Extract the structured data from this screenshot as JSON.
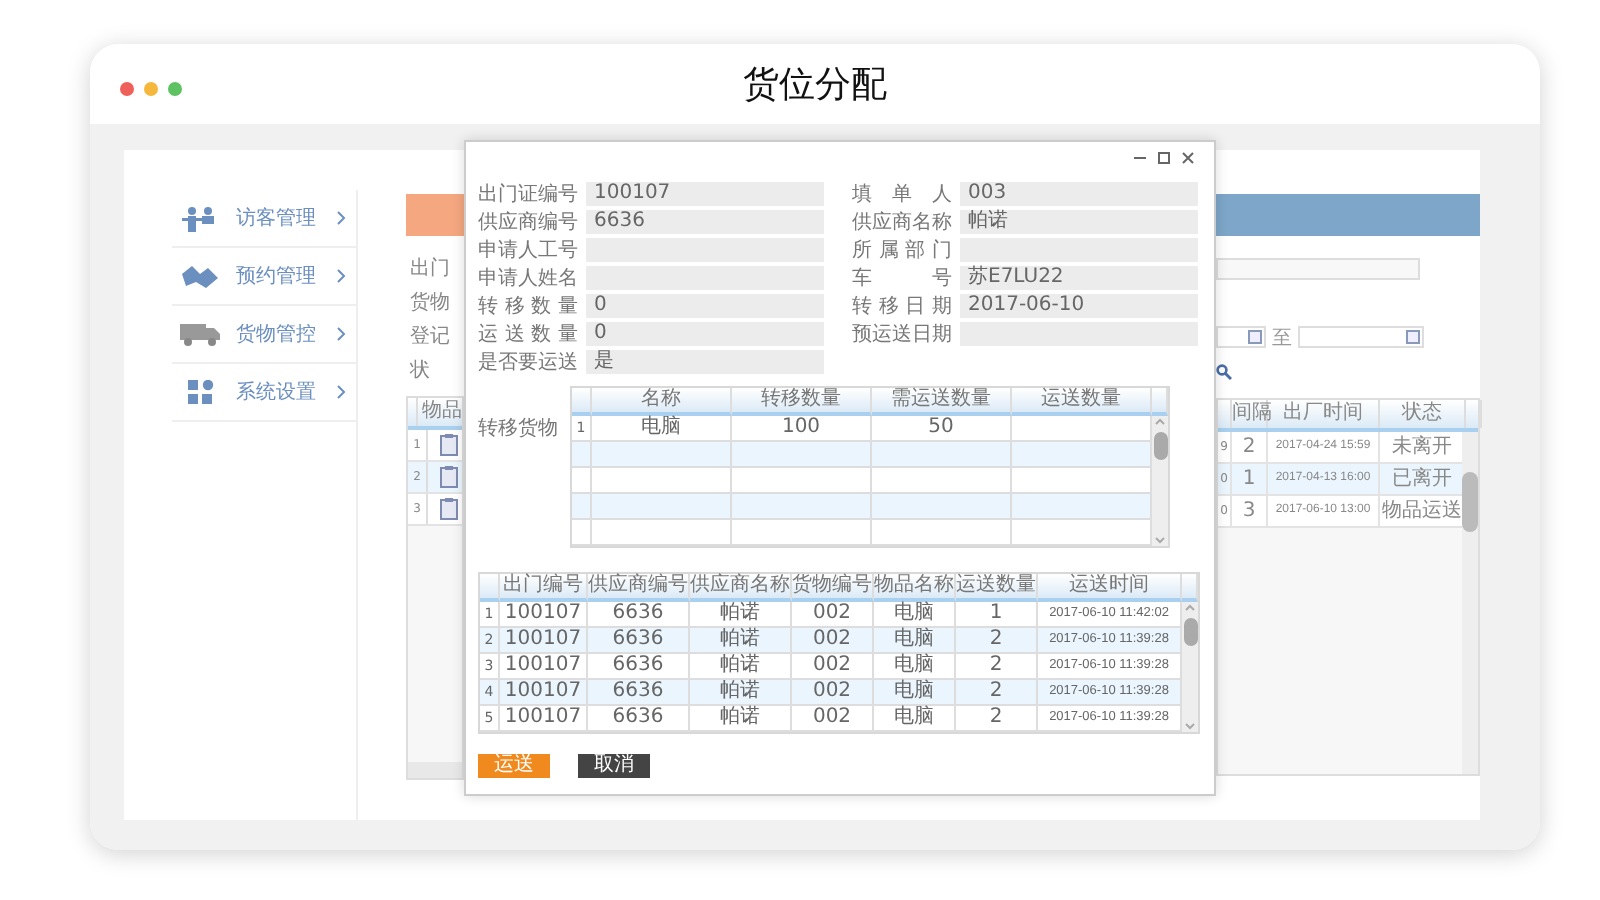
{
  "window": {
    "title": "货位分配"
  },
  "sidebar": {
    "items": [
      {
        "label": "访客管理"
      },
      {
        "label": "预约管理"
      },
      {
        "label": "货物管控"
      },
      {
        "label": "系统设置"
      }
    ]
  },
  "background": {
    "form_labels": [
      "出门",
      "货物",
      "登记",
      "状"
    ],
    "range_separator": "至",
    "table": {
      "partial_header": "物品",
      "row_numbers": [
        "1",
        "2",
        "3"
      ],
      "columns": [
        "间隔",
        "出厂时间",
        "状态"
      ],
      "rows": [
        {
          "column_1": "9",
          "interval": "2",
          "time": "2017-04-24 15:59",
          "status": "未离开"
        },
        {
          "column_1": "0",
          "interval": "1",
          "time": "2017-04-13 16:00",
          "status": "已离开"
        },
        {
          "column_1": "0",
          "interval": "3",
          "time": "2017-06-10 13:00",
          "status": "物品运送"
        }
      ]
    }
  },
  "dialog": {
    "fields_left": [
      {
        "label": "出门证编号",
        "value": "100107"
      },
      {
        "label": "供应商编号",
        "value": "6636"
      },
      {
        "label": "申请人工号"
      },
      {
        "label": "申请人姓名"
      },
      {
        "label": "转移数量",
        "value": "0"
      },
      {
        "label": "运送数量",
        "value": "0"
      },
      {
        "label": "是否要运送",
        "value": "是"
      }
    ],
    "fields_right": [
      {
        "label": "填单人",
        "value": "003"
      },
      {
        "label": "供应商名称",
        "value": "帕诺"
      },
      {
        "label": "所属部门"
      },
      {
        "label": "车号",
        "value": "苏E7LU22"
      },
      {
        "label": "转移日期",
        "value": "2017-06-10"
      },
      {
        "label": "预运送日期"
      }
    ],
    "goods_label": "转移货物",
    "goods_table": {
      "columns": [
        "名称",
        "转移数量",
        "需运送数量",
        "运送数量"
      ],
      "rows": [
        {
          "index": "1",
          "name": "电脑",
          "transfer": "100",
          "need": "50"
        }
      ]
    },
    "shipments_table": {
      "columns": [
        "出门编号",
        "供应商编号",
        "供应商名称",
        "货物编号",
        "物品名称",
        "运送数量",
        "运送时间"
      ],
      "rows": [
        {
          "index": "1",
          "cells": [
            "100107",
            "6636",
            "帕诺",
            "002",
            "电脑",
            "1",
            "2017-06-10 11:42:02"
          ]
        },
        {
          "index": "2",
          "cells": [
            "100107",
            "6636",
            "帕诺",
            "002",
            "电脑",
            "2",
            "2017-06-10 11:39:28"
          ]
        },
        {
          "index": "3",
          "cells": [
            "100107",
            "6636",
            "帕诺",
            "002",
            "电脑",
            "2",
            "2017-06-10 11:39:28"
          ]
        },
        {
          "index": "4",
          "cells": [
            "100107",
            "6636",
            "帕诺",
            "002",
            "电脑",
            "2",
            "2017-06-10 11:39:28"
          ]
        },
        {
          "index": "5",
          "cells": [
            "100107",
            "6636",
            "帕诺",
            "002",
            "电脑",
            "2",
            "2017-06-10 11:39:28"
          ]
        }
      ]
    },
    "buttons": [
      {
        "label": "运送",
        "kind": "primary"
      },
      {
        "label": "取消",
        "kind": "secondary"
      }
    ]
  }
}
